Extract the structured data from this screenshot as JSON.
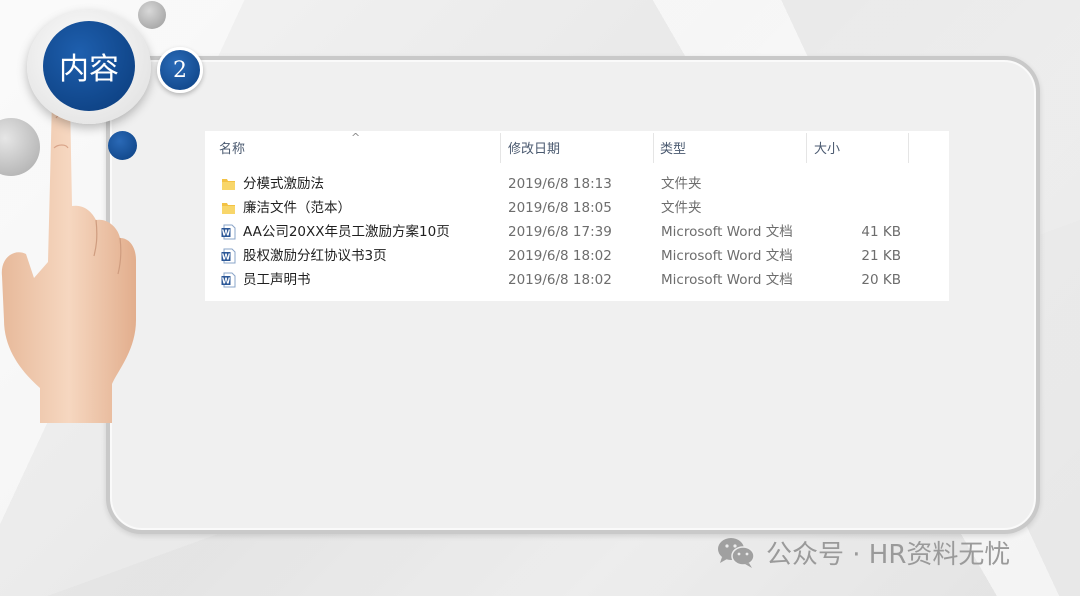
{
  "slide": {
    "badge_label": "内容",
    "badge_number": "2"
  },
  "explorer": {
    "columns": {
      "name": "名称",
      "date": "修改日期",
      "type": "类型",
      "size": "大小"
    },
    "sort_indicator": "^",
    "files": [
      {
        "name": "分模式激励法",
        "date": "2019/6/8 18:13",
        "type": "文件夹",
        "size": "",
        "icon": "folder-icon"
      },
      {
        "name": "廉洁文件（范本）",
        "date": "2019/6/8 18:05",
        "type": "文件夹",
        "size": "",
        "icon": "folder-icon"
      },
      {
        "name": "AA公司20XX年员工激励方案10页",
        "date": "2019/6/8 17:39",
        "type": "Microsoft Word 文档",
        "size": "41 KB",
        "icon": "word-document-icon"
      },
      {
        "name": "股权激励分红协议书3页",
        "date": "2019/6/8 18:02",
        "type": "Microsoft Word 文档",
        "size": "21 KB",
        "icon": "word-document-icon"
      },
      {
        "name": "员工声明书",
        "date": "2019/6/8 18:02",
        "type": "Microsoft Word 文档",
        "size": "20 KB",
        "icon": "word-document-icon"
      }
    ]
  },
  "watermark": {
    "text": "公众号 · HR资料无忧",
    "icon": "wechat-icon"
  },
  "colors": {
    "badge_blue": "#0b3f80",
    "folder_yellow": "#f3c244",
    "word_blue": "#2b5797"
  }
}
